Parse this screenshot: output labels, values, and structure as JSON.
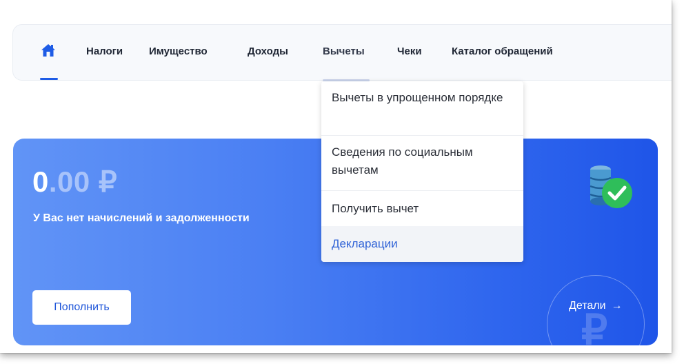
{
  "nav": {
    "home_icon": "home-icon",
    "items": [
      {
        "label": "Налоги"
      },
      {
        "label": "Имущество"
      },
      {
        "label": "Доходы"
      },
      {
        "label": "Вычеты"
      },
      {
        "label": "Чеки"
      },
      {
        "label": "Каталог обращений"
      }
    ],
    "active": "Вычеты"
  },
  "dropdown": {
    "items": [
      {
        "label": "Вычеты в упрощенном порядке"
      },
      {
        "label": "Сведения по социальным вычетам"
      },
      {
        "label": "Получить вычет"
      },
      {
        "label": "Декларации"
      }
    ],
    "highlighted": "Декларации"
  },
  "balance": {
    "amount_integer": "0",
    "amount_fraction": ".00 ₽",
    "subtitle": "У Вас нет начислений и задолженности",
    "topup_label": "Пополнить",
    "details_label": "Детали",
    "details_arrow": "→",
    "watermark_glyph": "₽",
    "status_icon": "coins-check-icon"
  },
  "colors": {
    "accent": "#1e5ce6",
    "card_gradient_start": "#6194f6",
    "card_gradient_end": "#1f55e8",
    "check_green": "#2fbe5a"
  }
}
